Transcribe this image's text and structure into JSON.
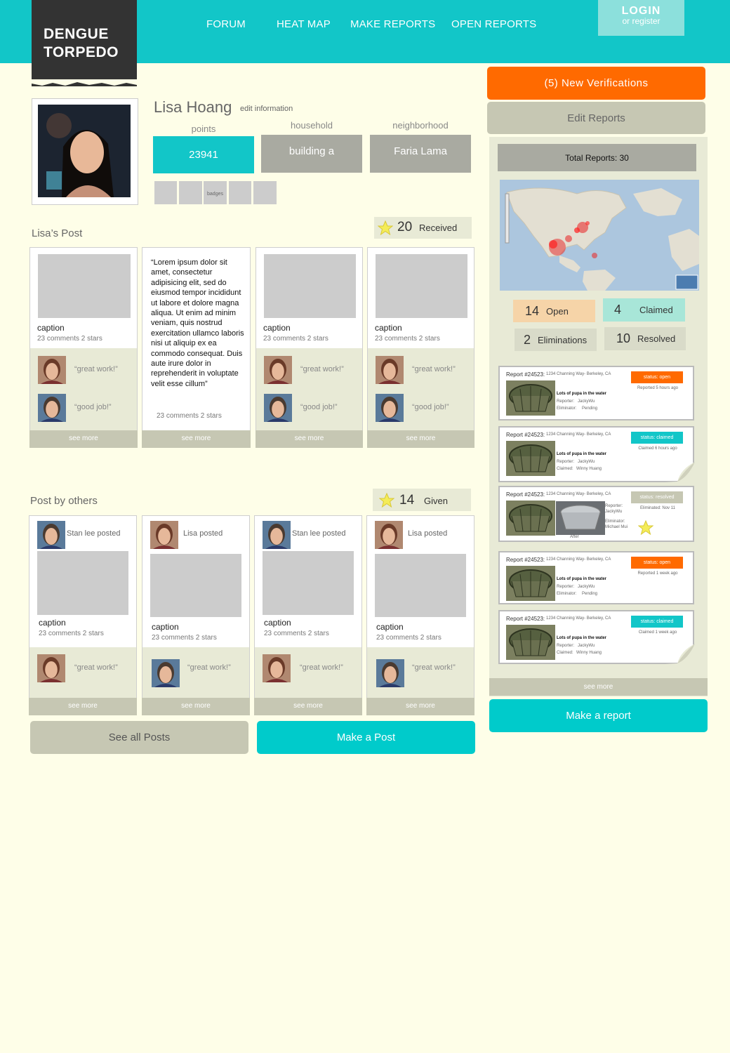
{
  "header": {
    "logo_line1": "DENGUE",
    "logo_line2": "TORPEDO",
    "nav": [
      "FORUM",
      "HEAT MAP",
      "MAKE REPORTS",
      "OPEN REPORTS"
    ],
    "login": "LOGIN",
    "register": "or register"
  },
  "profile": {
    "name": "Lisa Hoang",
    "edit_link": "edit information",
    "points_label": "points",
    "points": "23941",
    "household_label": "household",
    "household": "building a",
    "neighborhood_label": "neighborhood",
    "neighborhood": "Faria Lama",
    "badges_label": "badges"
  },
  "lisas_posts": {
    "heading": "Lisa’s Post",
    "star_count": "20",
    "star_label": "Received",
    "cards": [
      {
        "caption": "caption",
        "meta": "23 comments 2 stars",
        "c1": "“great work!”",
        "c2": "“good job!”",
        "more": "see more"
      },
      {
        "text": "“Lorem ipsum dolor sit amet, consectetur adipisicing elit, sed do eiusmod tempor incididunt ut labore et dolore magna aliqua. Ut enim ad minim veniam, quis nostrud exercitation ullamco laboris nisi ut aliquip ex ea commodo consequat. Duis aute irure dolor in reprehenderit in voluptate velit esse cillum”",
        "meta": "23 comments 2 stars",
        "more": "see more"
      },
      {
        "caption": "caption",
        "meta": "23 comments 2 stars",
        "c1": "“great work!”",
        "c2": "“good job!”",
        "more": "see more"
      },
      {
        "caption": "caption",
        "meta": "23 comments 2 stars",
        "c1": "“great work!”",
        "c2": "“good job!”",
        "more": "see more"
      }
    ]
  },
  "others_posts": {
    "heading": "Post by others",
    "star_count": "14",
    "star_label": "Given",
    "cards": [
      {
        "poster": "Stan lee posted",
        "caption": "caption",
        "meta": "23 comments 2 stars",
        "c1": "“great work!”",
        "more": "see more"
      },
      {
        "poster": "Lisa posted",
        "caption": "caption",
        "meta": "23 comments 2 stars",
        "c1": "“great work!”",
        "more": "see more"
      },
      {
        "poster": "Stan lee posted",
        "caption": "caption",
        "meta": "23 comments 2 stars",
        "c1": "“great work!”",
        "more": "see more"
      },
      {
        "poster": "Lisa posted",
        "caption": "caption",
        "meta": "23 comments 2 stars",
        "c1": "“great work!”",
        "more": "see more"
      }
    ],
    "see_all": "See all Posts",
    "make_post": "Make a Post"
  },
  "sidebar": {
    "new_verifications": "(5) New Verifications",
    "edit_reports": "Edit Reports",
    "total_reports": "Total Reports: 30",
    "stats": [
      {
        "num": "14",
        "label": "Open",
        "color": "#f6d4a8"
      },
      {
        "num": "4",
        "label": "Claimed",
        "color": "#a8e6d8"
      },
      {
        "num": "2",
        "label": "Eliminations",
        "color": "#d9dbc9"
      },
      {
        "num": "10",
        "label": "Resolved",
        "color": "#d9dbc9"
      }
    ],
    "reports": [
      {
        "id": "Report #24523:",
        "addr": "1234 Channing Way- Berkeley, CA",
        "status": "status: open",
        "status_color": "#ff6a00",
        "time": "Reported 5 hours ago",
        "title": "Lots of pupa in the water",
        "reporter_label": "Reporter:",
        "reporter": "JackyWu",
        "role_label": "Eliminator:",
        "role_value": "Pending"
      },
      {
        "id": "Report #24523:",
        "addr": "1234 Channing Way- Berkeley, CA",
        "status": "status: claimed",
        "status_color": "#12c6c8",
        "time": "Claimed 6 hours ago",
        "title": "Lots of pupa in the water",
        "reporter_label": "Reporter:",
        "reporter": "JackyWu",
        "role_label": "Claimed:",
        "role_value": "Winny Huang"
      },
      {
        "id": "Report #24523:",
        "addr": "1234 Channing Way- Berkeley, CA",
        "status": "status: resolved",
        "status_color": "#c6c7b3",
        "time": "Eliminated: Nov 11",
        "reporter_label": "Reporter:",
        "reporter": "JackyWu",
        "role_label": "Eliminator:",
        "role_value": "Michael Mui",
        "after": "After"
      },
      {
        "id": "Report #24523:",
        "addr": "1234 Channing Way- Berkeley, CA",
        "status": "status: open",
        "status_color": "#ff6a00",
        "time": "Reported 1 week ago",
        "title": "Lots of pupa in the water",
        "reporter_label": "Reporter:",
        "reporter": "JackyWu",
        "role_label": "Eliminator:",
        "role_value": "Pending"
      },
      {
        "id": "Report #24523:",
        "addr": "1234 Channing Way- Berkeley, CA",
        "status": "status: claimed",
        "status_color": "#12c6c8",
        "time": "Claimed 1 week ago",
        "title": "Lots of pupa in the water",
        "reporter_label": "Reporter:",
        "reporter": "JackyWu",
        "role_label": "Claimed:",
        "role_value": "Winny Huang"
      }
    ],
    "see_more": "see more",
    "make_report": "Make a report"
  }
}
